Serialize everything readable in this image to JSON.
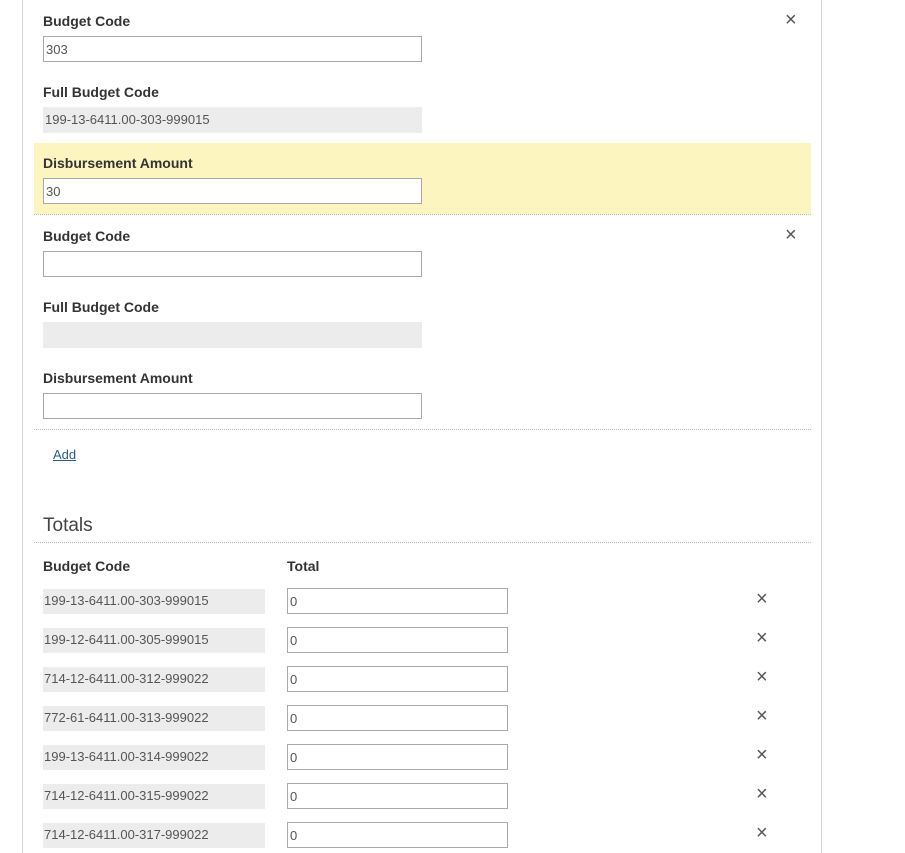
{
  "entries": [
    {
      "budget_code_label": "Budget Code",
      "budget_code_value": "303",
      "full_budget_code_label": "Full Budget Code",
      "full_budget_code_value": "199-13-6411.00-303-999015",
      "disbursement_label": "Disbursement Amount",
      "disbursement_value": "30",
      "remove_icon": "×"
    },
    {
      "budget_code_label": "Budget Code",
      "budget_code_value": "",
      "full_budget_code_label": "Full Budget Code",
      "full_budget_code_value": "",
      "disbursement_label": "Disbursement Amount",
      "disbursement_value": "",
      "remove_icon": "×"
    }
  ],
  "add_label": "Add",
  "totals": {
    "title": "Totals",
    "col_budget_code": "Budget Code",
    "col_total": "Total",
    "remove_icon": "×",
    "rows": [
      {
        "code": "199-13-6411.00-303-999015",
        "total": "0"
      },
      {
        "code": "199-12-6411.00-305-999015",
        "total": "0"
      },
      {
        "code": "714-12-6411.00-312-999022",
        "total": "0"
      },
      {
        "code": "772-61-6411.00-313-999022",
        "total": "0"
      },
      {
        "code": "199-13-6411.00-314-999022",
        "total": "0"
      },
      {
        "code": "714-12-6411.00-315-999022",
        "total": "0"
      },
      {
        "code": "714-12-6411.00-317-999022",
        "total": "0"
      }
    ]
  },
  "colors": {
    "highlight": "#fdf5c0",
    "readonly_bg": "#ececec",
    "link": "#2a5b8a"
  }
}
